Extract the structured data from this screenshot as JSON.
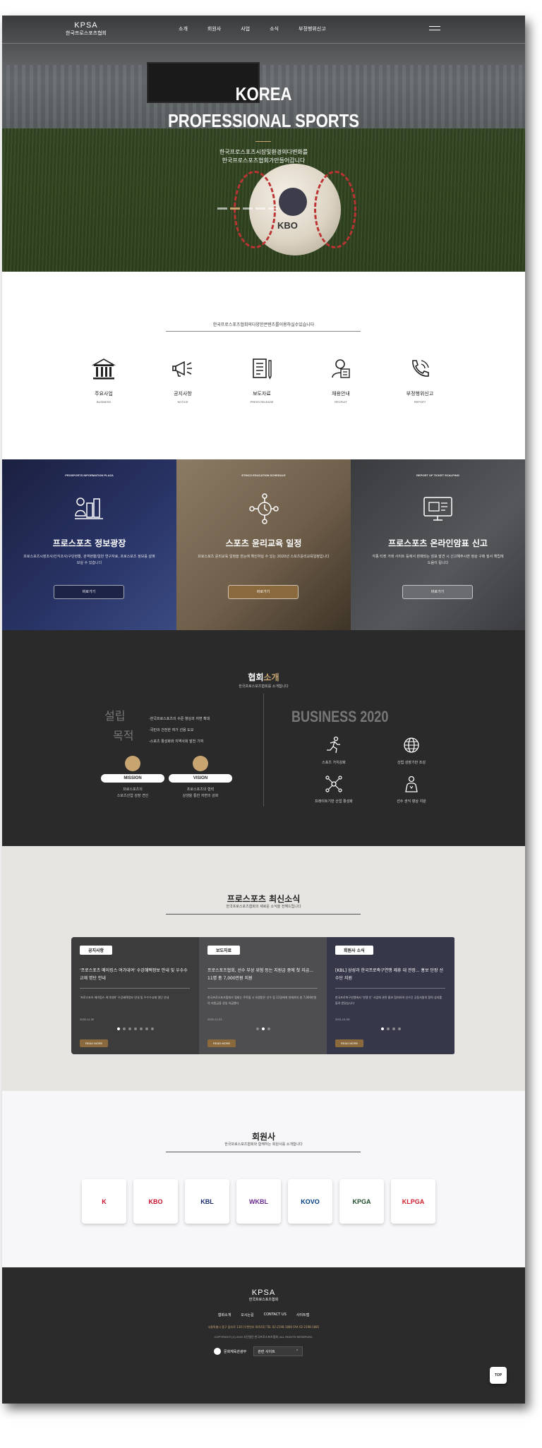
{
  "header": {
    "brand": "KPSA",
    "brand_sub": "한국프로스포츠협회",
    "menu": [
      "소개",
      "회원사",
      "사업",
      "소식",
      "부정행위신고"
    ]
  },
  "hero": {
    "title_line1": "KOREA",
    "title_line2": "PROFESSIONAL SPORTS",
    "subtitle_line1": "한국프로스포츠시장및환경의다변화를",
    "subtitle_line2": "한국프로스포츠협회가만들어갑니다",
    "ball_label": "KBO",
    "slides_total": 5,
    "slide_active": 2
  },
  "quick": {
    "caption": "한국프로스포츠협회의다양한콘텐츠를이용하실수있습니다",
    "items": [
      {
        "ko": "주요사업",
        "en": "BUSINESS",
        "icon": "building-icon"
      },
      {
        "ko": "공지사항",
        "en": "NOTICE",
        "icon": "megaphone-icon"
      },
      {
        "ko": "보도자료",
        "en": "PRESS RELEASE",
        "icon": "document-icon"
      },
      {
        "ko": "채용안내",
        "en": "RECRUIT",
        "icon": "recruit-icon"
      },
      {
        "ko": "부정행위신고",
        "en": "REPORT",
        "icon": "phone-icon"
      }
    ]
  },
  "cards": [
    {
      "tag": "PROSPORTS INFORMATION PLAZA",
      "title": "프로스포츠 정보광장",
      "desc": "프로스포츠시장조사/인식조사/구단현황, 관객현황/일반 연구자료, 프로스포츠 정보를 살펴보실 수 있습니다",
      "button": "바로가기",
      "icon": "chart-people-icon"
    },
    {
      "tag": "ETHICS EDUCATION SCHEDULE",
      "title": "스포츠 윤리교육 일정",
      "desc": "프로스포츠 윤리교육 일정을 한눈에 확인하실 수 있는 2020년 스포츠윤리교육일정입니다",
      "button": "바로가기",
      "icon": "network-clock-icon"
    },
    {
      "tag": "REPORT OF TICKET SCALPING",
      "title": "프로스포츠 온라인암표 신고",
      "desc": "각종 티켓 거래 사이트 등에서 판매되는 암표 발견 시 신고해주시면 정상 구매 질서 확립에 도움이 됩니다",
      "button": "바로가기",
      "icon": "monitor-ticket-icon"
    }
  ],
  "about": {
    "title_plain": "협회",
    "title_accent": "소개",
    "subtitle": "한국프로스포츠협회를 소개합니다",
    "establish_word1": "설립",
    "establish_word2": "목적",
    "goals": [
      "-한국프로스포츠의 수준 향상과 저변 확대",
      "-국민의 건전한 여가 선용 도모",
      "-스포츠 활성화와 지역사회 발전 기여"
    ],
    "mission_label": "MISSION",
    "mission_text_line1": "프로스포츠의",
    "mission_text_line2": "스포츠산업 성장 견인",
    "vision_label": "VISION",
    "vision_text_line1": "프로스포츠의 협력",
    "vision_text_line2": "상생을 통한 저변의 강화",
    "business_title": "BUSINESS 2020",
    "business_items": [
      {
        "label": "스포츠 가치강화",
        "icon": "runner-icon"
      },
      {
        "label": "산업 성장기반 조성",
        "icon": "globe-icon"
      },
      {
        "label": "프레이트기반 산업 활성화",
        "icon": "network-icon"
      },
      {
        "label": "선수 권익 향상 지원",
        "icon": "player-icon"
      }
    ]
  },
  "news": {
    "title": "프로스포츠 최신소식",
    "subtitle": "한국프로스포츠협회의 새로운 소식을 전해드립니다",
    "items": [
      {
        "label": "공지사항",
        "title": "'프로스포츠 메이킹스 여가대여' 수강혜택정보 안내 및 우수수교재 명단 안내",
        "desc": "'프로스포츠 메이킹스 여가대여' 수강혜택정보 안내 및 우수수교재 명단 안내",
        "date": "2020-11-30",
        "more": "READ MORE",
        "pages": 7,
        "active": 0
      },
      {
        "label": "보도자료",
        "title": "프로스포츠협회, 선수 부상 위험 등는 지원금 중에 첫 지급... 11명 총 7,000만원 지원",
        "desc": "한국프로스포츠협회가 협회는 주목될 시 지원받은 선수 등 11명에게 현재까지 총 7,000만원의 지원금을 성실 지급했다",
        "date": "2020-12-23",
        "more": "READ MORE",
        "pages": 3,
        "active": 1
      },
      {
        "label": "회원사 소식",
        "title": "[KBL] 삼성과 한국프로축구연맹 제휴 대 관장...  홍보 단장 선수단 지원",
        "desc": "한국프로축구연맹에서 '연맹 인' 사업에 관련 홍보 참여하여 선수단 공동지원의 협력 성과를 돌려 받았습니다",
        "date": "2021-01-05",
        "more": "READ MORE",
        "pages": 4,
        "active": 0
      }
    ]
  },
  "members": {
    "title": "회원사",
    "subtitle": "한국프로스포츠협회와 함께하는 회원사를 소개합니다",
    "logos": [
      {
        "name": "K LEAGUE",
        "mark": "K",
        "color": "#c8102e"
      },
      {
        "name": "KBO",
        "mark": "KBO",
        "color": "#c8102e"
      },
      {
        "name": "KBL",
        "mark": "KBL",
        "color": "#1a2a6c"
      },
      {
        "name": "WKBL",
        "mark": "WKBL",
        "color": "#6b2c91"
      },
      {
        "name": "KOVO",
        "mark": "KOVO",
        "color": "#003c82"
      },
      {
        "name": "KPGA",
        "mark": "KPGA",
        "color": "#1f4d2b"
      },
      {
        "name": "KLPGA",
        "mark": "KLPGA",
        "color": "#d21f2f"
      }
    ]
  },
  "footer": {
    "brand": "KPSA",
    "brand_sub": "한국프로스포츠협회",
    "links": [
      "협회소개",
      "오시는길",
      "CONTACT US",
      "사이트맵"
    ],
    "address": "서울특별시 중구 을지로 130 [우편번호 04543] TEL 02-2198-1880 FAX 02-2198-1881",
    "copyright": "COPYRIGHT (C) 2019 사단법인 한국프로스포츠협회. ALL RIGHTS RESERVED.",
    "ministry": "문화체육관광부",
    "related": "관련 사이트",
    "top": "TOP"
  }
}
